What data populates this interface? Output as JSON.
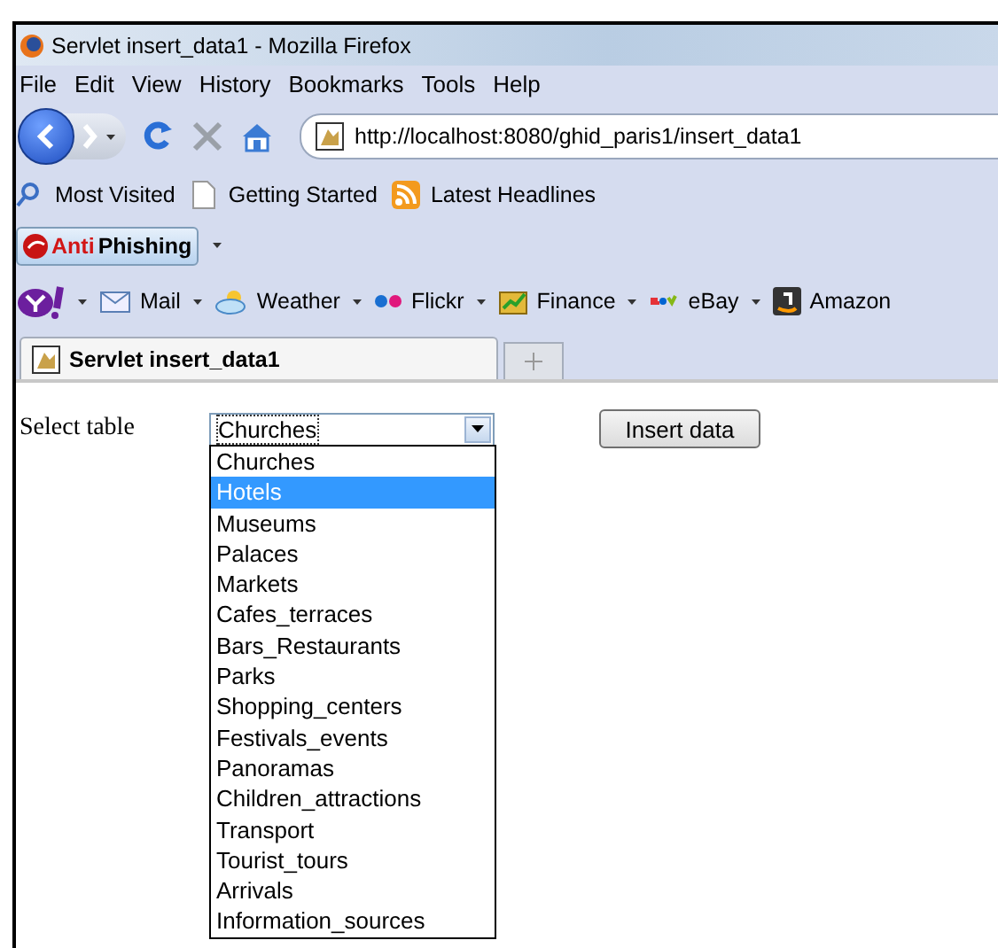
{
  "window": {
    "title": "Servlet insert_data1 - Mozilla Firefox"
  },
  "menu": [
    "File",
    "Edit",
    "View",
    "History",
    "Bookmarks",
    "Tools",
    "Help"
  ],
  "address": {
    "value": "http://localhost:8080/ghid_paris1/insert_data1"
  },
  "bookmarks": [
    "Most Visited",
    "Getting Started",
    "Latest Headlines"
  ],
  "antiphishing": {
    "prefix": "Anti",
    "rest": "Phishing"
  },
  "yahoo_toolbar": [
    "Mail",
    "Weather",
    "Flickr",
    "Finance",
    "eBay",
    "Amazon"
  ],
  "tabs": [
    {
      "label": "Servlet insert_data1",
      "selected": true
    }
  ],
  "form": {
    "label": "Select table",
    "select_value": "Churches",
    "button": "Insert data",
    "options": [
      {
        "label": "Churches",
        "selected": false
      },
      {
        "label": "Hotels",
        "selected": true
      },
      {
        "label": "Museums",
        "selected": false
      },
      {
        "label": "Palaces",
        "selected": false
      },
      {
        "label": "Markets",
        "selected": false
      },
      {
        "label": "Cafes_terraces",
        "selected": false
      },
      {
        "label": "Bars_Restaurants",
        "selected": false
      },
      {
        "label": "Parks",
        "selected": false
      },
      {
        "label": "Shopping_centers",
        "selected": false
      },
      {
        "label": "Festivals_events",
        "selected": false
      },
      {
        "label": "Panoramas",
        "selected": false
      },
      {
        "label": "Children_attractions",
        "selected": false
      },
      {
        "label": "Transport",
        "selected": false
      },
      {
        "label": "Tourist_tours",
        "selected": false
      },
      {
        "label": "Arrivals",
        "selected": false
      },
      {
        "label": "Information_sources",
        "selected": false
      }
    ]
  }
}
